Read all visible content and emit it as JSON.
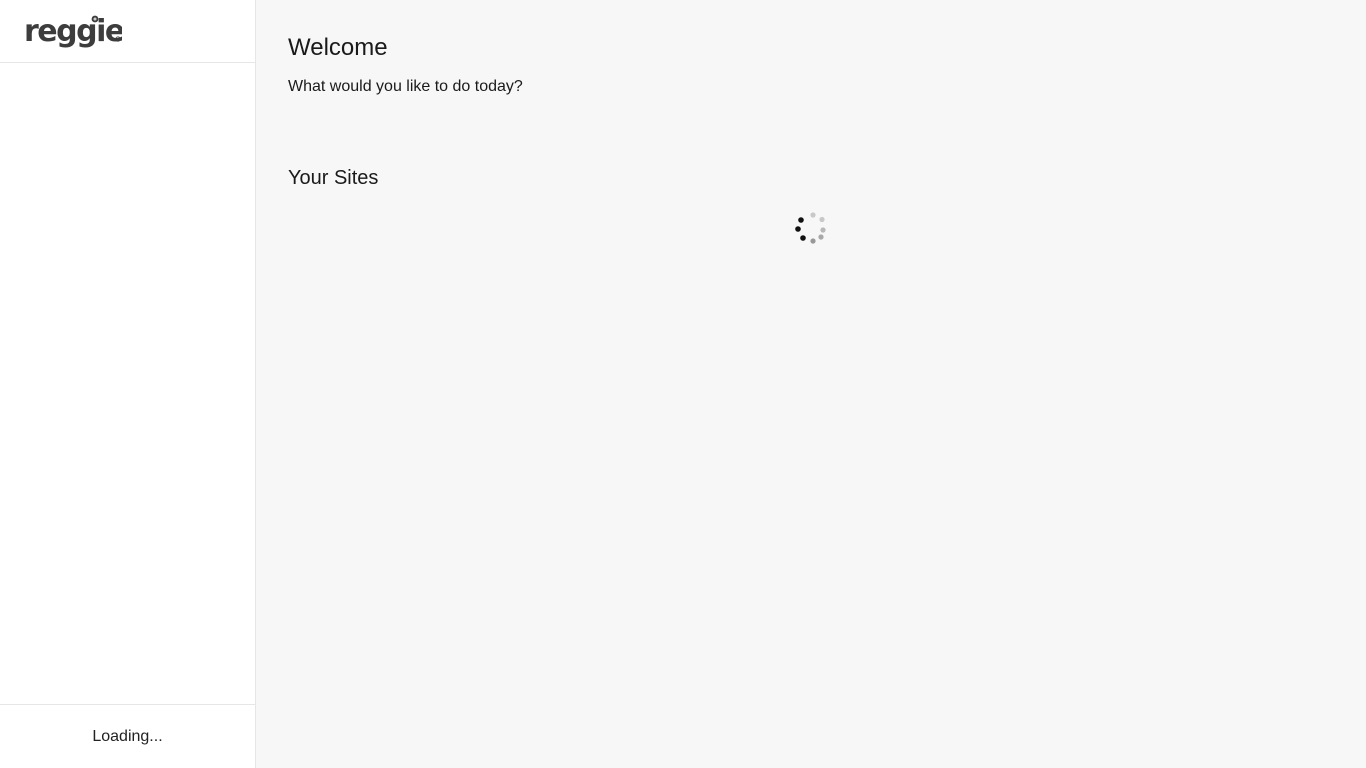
{
  "brand": {
    "logo_text": "reggie",
    "logo_color": "#3d3d3d"
  },
  "sidebar": {
    "footer_status": "Loading..."
  },
  "main": {
    "title": "Welcome",
    "subtitle": "What would you like to do today?",
    "sites_heading": "Your Sites",
    "sites_loading_icon": "loading-spinner-icon"
  }
}
